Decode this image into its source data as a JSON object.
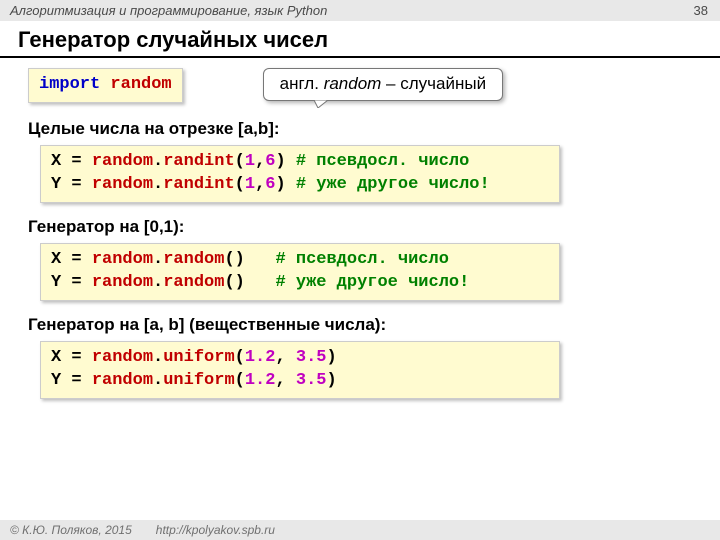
{
  "header": {
    "course": "Алгоритмизация и программирование, язык Python",
    "page": "38"
  },
  "title": "Генератор случайных чисел",
  "import_stmt": {
    "kw": "import",
    "mod": "random"
  },
  "callout": {
    "pre": "англ. ",
    "word": "random",
    "post": " – случайный"
  },
  "sections": {
    "ints": {
      "heading": "Целые числа на отрезке [a,b]:",
      "l1": {
        "v": "X",
        "eq": "=",
        "sp": " ",
        "obj": "random",
        "dot": ".",
        "fn": "randint",
        "lp": "(",
        "a": "1",
        "c": ",",
        "b": "6",
        "rp": ")",
        "cmt": "# псевдосл. число"
      },
      "l2": {
        "v": "Y",
        "eq": "=",
        "sp": " ",
        "obj": "random",
        "dot": ".",
        "fn": "randint",
        "lp": "(",
        "a": "1",
        "c": ",",
        "b": "6",
        "rp": ")",
        "cmt": "# уже другое число!"
      }
    },
    "rand01": {
      "heading": "Генератор на [0,1):",
      "l1": {
        "v": "X",
        "eq": "=",
        "sp": " ",
        "obj": "random",
        "dot": ".",
        "fn": "random",
        "lp": "(",
        "rp": ")",
        "cmt": "# псевдосл. число"
      },
      "l2": {
        "v": "Y",
        "eq": "=",
        "sp": " ",
        "obj": "random",
        "dot": ".",
        "fn": "random",
        "lp": "(",
        "rp": ")",
        "cmt": "# уже другое число!"
      }
    },
    "uniform": {
      "heading": "Генератор на [a, b] (вещественные числа):",
      "l1": {
        "v": "X",
        "eq": "=",
        "sp": " ",
        "obj": "random",
        "dot": ".",
        "fn": "uniform",
        "lp": "(",
        "a": "1.2",
        "c": ",",
        "sp2": " ",
        "b": "3.5",
        "rp": ")"
      },
      "l2": {
        "v": "Y",
        "eq": "=",
        "sp": " ",
        "obj": "random",
        "dot": ".",
        "fn": "uniform",
        "lp": "(",
        "a": "1.2",
        "c": ",",
        "sp2": " ",
        "b": "3.5",
        "rp": ")"
      }
    }
  },
  "footer": {
    "copyright": "© К.Ю. Поляков, 2015",
    "url": "http://kpolyakov.spb.ru"
  }
}
